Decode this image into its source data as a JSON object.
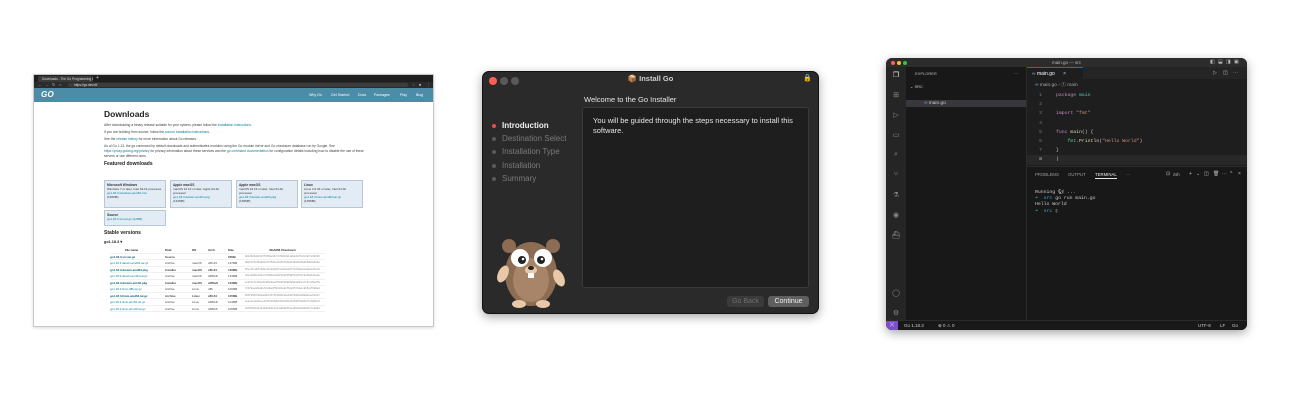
{
  "browser": {
    "tab_title": "Downloads - The Go Programming Language",
    "new_tab": "+",
    "url": "https://go.dev/dl/",
    "header": {
      "logo": "GO",
      "nav": [
        "Why Go",
        "Get Started",
        "Docs",
        "Packages",
        "Play",
        "Blog"
      ]
    },
    "content": {
      "title": "Downloads",
      "p1a": "After downloading a binary release suitable for your system, please follow the ",
      "p1_link": "installation instructions",
      "p1b": ".",
      "p2a": "If you are building from source, follow the ",
      "p2_link": "source installation instructions",
      "p2b": ".",
      "p3a": "See the ",
      "p3_link": "release history",
      "p3b": " for more information about Go releases.",
      "p4a": "As of Go 1.13, the go command by default downloads and authenticates modules using the Go module mirror and Go checksum database run by Google. See ",
      "p4_link1": "https://proxy.golang.org/privacy",
      "p4b": " for privacy information about these services and the ",
      "p4_link2": "go command documentation",
      "p4c": " for configuration details including how to disable the use of these servers or use different ones.",
      "featured_heading": "Featured downloads",
      "featured": [
        {
          "os": "Microsoft Windows",
          "desc": "Windows 7 or later, Intel 64-bit processor",
          "file": "go1.18.3.windows-amd64.msi",
          "size": "(130MB)"
        },
        {
          "os": "Apple macOS",
          "desc": "macOS 10.13 or later, Apple 64-bit processor",
          "file": "go1.18.3.darwin-arm64.pkg",
          "size": "(134MB)"
        },
        {
          "os": "Apple macOS",
          "desc": "macOS 10.13 or later, Intel 64-bit processor",
          "file": "go1.18.3.darwin-amd64.pkg",
          "size": "(138MB)"
        },
        {
          "os": "Linux",
          "desc": "Linux 2.6.32 or later, Intel 64-bit processor",
          "file": "go1.18.3.linux-amd64.tar.gz",
          "size": "(135MB)"
        }
      ],
      "source_card": {
        "os": "Source",
        "file": "go1.18.3.src.tar.gz",
        "size": "(22MB)"
      },
      "stable_heading": "Stable versions",
      "version": "go1.18.3 ▾",
      "table_headers": [
        "File name",
        "Kind",
        "OS",
        "Arch",
        "Size",
        "SHA256 Checksum"
      ],
      "rows": [
        {
          "file": "go1.18.3.src.tar.gz",
          "kind": "Source",
          "os": "",
          "arch": "",
          "size": "22MB",
          "sum": "0012386ddcbb5f3350e407c679923811dbd283fcdc421724931614a842ecbc2d",
          "key": true
        },
        {
          "file": "go1.18.3.darwin-amd64.tar.gz",
          "kind": "Archive",
          "os": "macOS",
          "arch": "x86-64",
          "size": "137MB",
          "sum": "d9dcf8fc35da54c6f259be41954783a9f4984945a855d03a003a7fd6ea4c5ca1",
          "key": false
        },
        {
          "file": "go1.18.3.darwin-amd64.pkg",
          "kind": "Installer",
          "os": "macOS",
          "arch": "x86-64",
          "size": "138MB",
          "sum": "85ecd7e30fe9d8ef8c0a3b3f1c6b4e2bf7a3f8de8e6a9e61b1c9efb36c05a9e2",
          "key": true
        },
        {
          "file": "go1.18.3.darwin-arm64.tar.gz",
          "kind": "Archive",
          "os": "macOS",
          "arch": "ARMv8",
          "size": "133MB",
          "sum": "40ecd383c941cc9f0682e6a6f2a333539f1a3f2cc8e5d4b1ba1a4a7fae3a5c5e",
          "key": false
        },
        {
          "file": "go1.18.3.darwin-arm64.pkg",
          "kind": "Installer",
          "os": "macOS",
          "arch": "ARMv8",
          "size": "133MB",
          "sum": "4e4f4e2c4b0c2b4d1b0ae0f3a6f0b9b6a8d3e5b7a7c3c1d3a2f0e9b8c7d6e5f4",
          "key": true
        },
        {
          "file": "go1.18.3.linux-386.tar.gz",
          "kind": "Archive",
          "os": "Linux",
          "arch": "x86",
          "size": "106MB",
          "sum": "72b73ae4d2a0a7d1d3e0f6b4d1a8c5b2e9f7d4a1c8b5e2f9d6a3c0b7e4d1a8c5",
          "key": false
        },
        {
          "file": "go1.18.3.linux-amd64.tar.gz",
          "kind": "Archive",
          "os": "Linux",
          "arch": "x86-64",
          "size": "135MB",
          "sum": "956f8507b302ab0bb747613695cdae10af99bbd39a90cae522b7c0302cc27245",
          "key": true
        },
        {
          "file": "go1.18.3.linux-arm64.tar.gz",
          "kind": "Archive",
          "os": "Linux",
          "arch": "ARMv8",
          "size": "104MB",
          "sum": "beacbe1441bee4d7978b900136d1d6a71d150f0a9bb77e9d50c822065623a35a",
          "key": false
        },
        {
          "file": "go1.18.3.linux-armv6l.tar.gz",
          "kind": "Archive",
          "os": "Linux",
          "arch": "ARMv6",
          "size": "105MB",
          "sum": "b8f0b5db24114388d5dcba7ca0698510ea05228b0402fcbeb0881f74ae9cb83b",
          "key": false
        }
      ]
    }
  },
  "installer": {
    "title": "Install Go",
    "heading": "Welcome to the Go Installer",
    "body": "You will be guided through the steps necessary to install this software.",
    "steps": [
      "Introduction",
      "Destination Select",
      "Installation Type",
      "Installation",
      "Summary"
    ],
    "current_step": 0,
    "go_back": "Go Back",
    "continue": "Continue"
  },
  "vscode": {
    "title": "main.go — src",
    "explorer": "EXPLORER",
    "explorer_more": "···",
    "folder": "SRC",
    "file": "main.go",
    "outline_folder": "GO",
    "tab": "main.go",
    "breadcrumb": "main.go › ⓕ main",
    "code": {
      "package_kw": "package",
      "package_name": "main",
      "import_kw": "import",
      "import_path": "\"fmt\"",
      "func_kw": "func",
      "func_name": "main",
      "func_tail": "() {",
      "call_pkg": "fmt",
      "call_fn": "Println",
      "call_arg": "\"Hello World\"",
      "close": "}"
    },
    "panel_tabs": [
      "PROBLEMS",
      "OUTPUT",
      "TERMINAL",
      "···"
    ],
    "active_panel_tab": 2,
    "terminal_shell": "zsh",
    "terminal": {
      "l1": "Running 🐿 ...",
      "l2_cmd": "go run main.go",
      "l3": "Hello World",
      "dir": "src"
    },
    "status": {
      "remote": "⟩⟨",
      "go_version": "Go 1.18.3",
      "problems": "⊗ 0 ⚠ 0",
      "encoding": "UTF-8",
      "eol": "LF",
      "lang": "Go"
    }
  }
}
